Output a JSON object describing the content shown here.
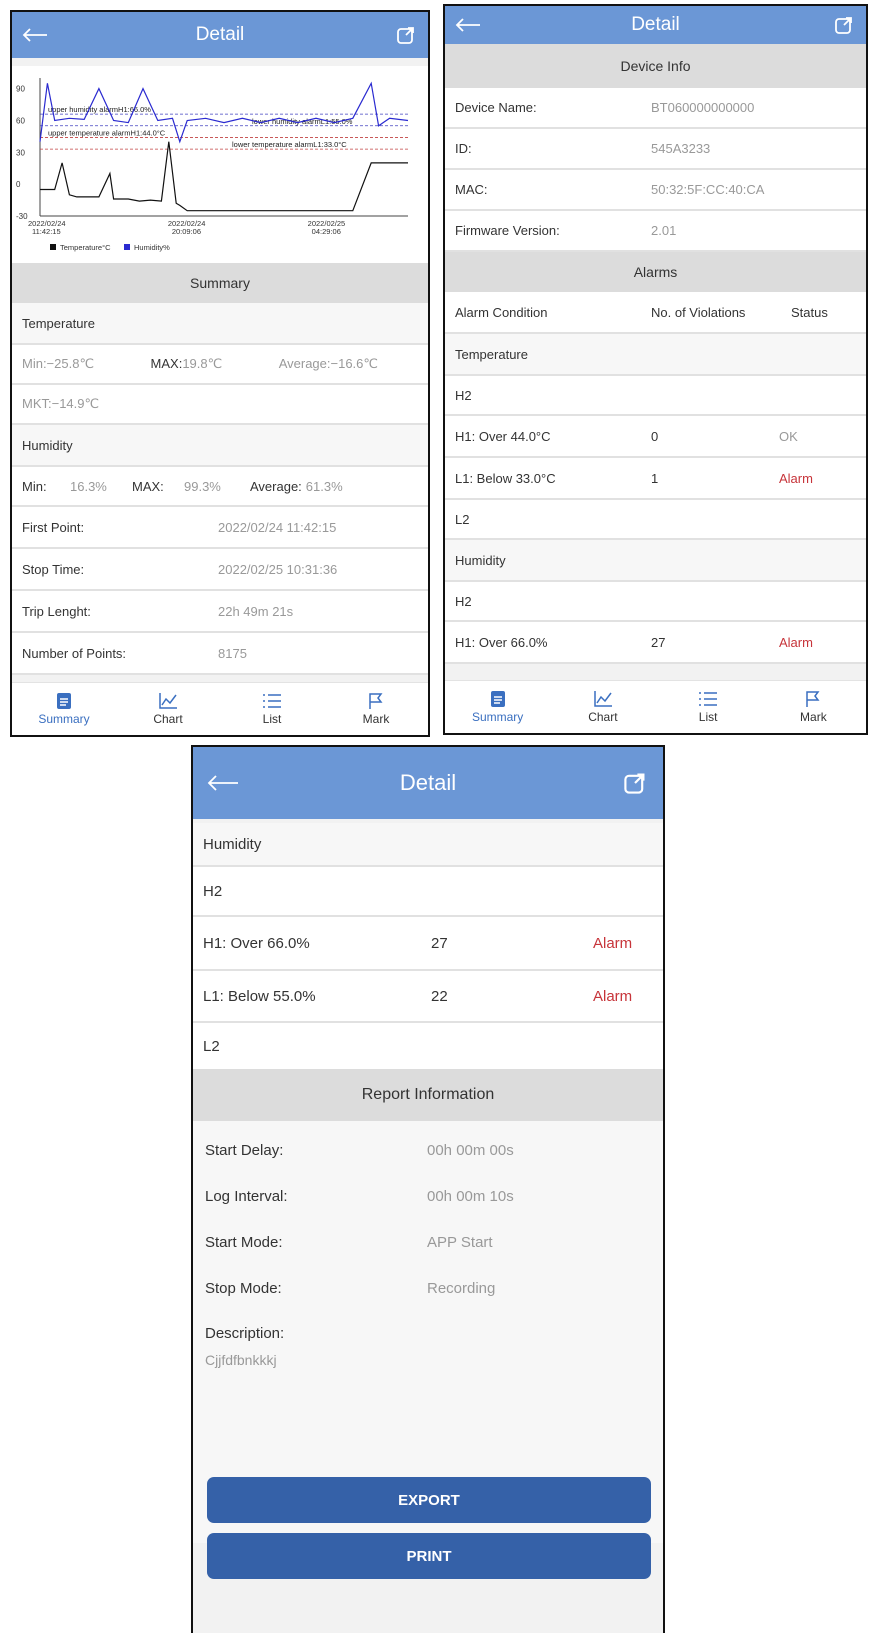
{
  "screens": {
    "summary": {
      "title": "Detail",
      "chart_data": {
        "type": "line",
        "y_ticks": [
          "90",
          "60",
          "30",
          "0",
          "-30"
        ],
        "x_ticks": [
          {
            "date": "2022/02/24",
            "time": "11:42:15"
          },
          {
            "date": "2022/02/24",
            "time": "20:09:06"
          },
          {
            "date": "2022/02/25",
            "time": "04:29:06"
          }
        ],
        "ylim": [
          -30,
          100
        ],
        "annotations": [
          {
            "text": "upper humidity alarmH1:66.0%",
            "y": 66,
            "color": "#4040c0"
          },
          {
            "text": "upper temperature alarmH1:44.0°C",
            "y": 44,
            "color": "#c04040"
          },
          {
            "text": "lower humidity alarmL1:55.0%",
            "y": 55,
            "color": "#4040c0"
          },
          {
            "text": "lower temperature alarmL1:33.0°C",
            "y": 33,
            "color": "#c04040"
          }
        ],
        "series": [
          {
            "name": "Temperature°C",
            "color": "#111111",
            "x": [
              0,
              0.04,
              0.06,
              0.08,
              0.1,
              0.16,
              0.19,
              0.2,
              0.24,
              0.27,
              0.3,
              0.33,
              0.35,
              0.37,
              0.38,
              0.4,
              0.6,
              0.85,
              0.9,
              0.92,
              0.95,
              1.0
            ],
            "values": [
              -5,
              -5,
              20,
              -10,
              -12,
              -12,
              10,
              -14,
              -14,
              -16,
              -15,
              -16,
              40,
              -18,
              -20,
              -25,
              -25,
              -25,
              20,
              20,
              20,
              20
            ]
          },
          {
            "name": "Humidity%",
            "color": "#2a2ad0",
            "x": [
              0,
              0.02,
              0.04,
              0.08,
              0.12,
              0.16,
              0.2,
              0.24,
              0.28,
              0.32,
              0.36,
              0.38,
              0.4,
              0.45,
              0.5,
              0.55,
              0.6,
              0.65,
              0.7,
              0.75,
              0.8,
              0.85,
              0.9,
              0.92,
              0.95,
              1.0
            ],
            "values": [
              40,
              95,
              60,
              62,
              61,
              90,
              60,
              58,
              90,
              60,
              62,
              40,
              60,
              62,
              58,
              62,
              58,
              62,
              58,
              62,
              58,
              62,
              95,
              55,
              62,
              60
            ]
          }
        ]
      },
      "legend": {
        "temp": "Temperature°C",
        "hum": "Humidity%"
      },
      "summary_header": "Summary",
      "temperature_header": "Temperature",
      "temp_min": "Min:−25.8℃",
      "temp_max_label": "MAX:",
      "temp_max_value": "19.8℃",
      "temp_avg": "Average:−16.6℃",
      "temp_mkt": "MKT:−14.9℃",
      "humidity_header": "Humidity",
      "hum_min_label": "Min:",
      "hum_min_value": "16.3%",
      "hum_max_label": "MAX:",
      "hum_max_value": "99.3%",
      "hum_avg_label": "Average:",
      "hum_avg_value": "61.3%",
      "info_rows": [
        {
          "label": "First Point:",
          "value": "2022/02/24 11:42:15"
        },
        {
          "label": "Stop Time:",
          "value": "2022/02/25 10:31:36"
        },
        {
          "label": "Trip Lenght:",
          "value": "22h 49m 21s"
        },
        {
          "label": "Number of Points:",
          "value": "8175"
        }
      ]
    },
    "device": {
      "title": "Detail",
      "device_info_header": "Device Info",
      "device_rows": [
        {
          "label": "Device Name:",
          "value": "BT060000000000"
        },
        {
          "label": "ID:",
          "value": "545A3233"
        },
        {
          "label": "MAC:",
          "value": "50:32:5F:CC:40:CA"
        },
        {
          "label": "Firmware Version:",
          "value": "2.01"
        }
      ],
      "alarms_header": "Alarms",
      "alarm_columns": {
        "condition": "Alarm Condition",
        "violations": "No. of Violations",
        "status": "Status"
      },
      "temperature_header": "Temperature",
      "temp_h2": "H2",
      "temp_h1": {
        "condition": "H1: Over 44.0°C",
        "count": "0",
        "status": "OK"
      },
      "temp_l1": {
        "condition": "L1: Below 33.0°C",
        "count": "1",
        "status": "Alarm"
      },
      "temp_l2": "L2",
      "humidity_header": "Humidity",
      "hum_h2": "H2",
      "hum_h1": {
        "condition": "H1: Over 66.0%",
        "count": "27",
        "status": "Alarm"
      }
    },
    "report": {
      "title": "Detail",
      "humidity_header": "Humidity",
      "hum_h2": "H2",
      "hum_h1": {
        "condition": "H1: Over 66.0%",
        "count": "27",
        "status": "Alarm"
      },
      "hum_l1": {
        "condition": "L1: Below 55.0%",
        "count": "22",
        "status": "Alarm"
      },
      "hum_l2": "L2",
      "report_header": "Report Information",
      "report_rows": [
        {
          "label": "Start Delay:",
          "value": "00h 00m 00s"
        },
        {
          "label": "Log Interval:",
          "value": "00h 00m 10s"
        },
        {
          "label": "Start Mode:",
          "value": "APP Start"
        },
        {
          "label": "Stop Mode:",
          "value": "Recording"
        }
      ],
      "description_label": "Description:",
      "description_value": "Cjjfdfbnkkkj",
      "export_label": "EXPORT",
      "print_label": "PRINT"
    }
  },
  "nav": {
    "summary": "Summary",
    "chart": "Chart",
    "list": "List",
    "mark": "Mark"
  },
  "colors": {
    "header": "#6b97d6",
    "alarm": "#c7343a",
    "button": "#3561a8",
    "nav_active": "#3a6fc0"
  }
}
